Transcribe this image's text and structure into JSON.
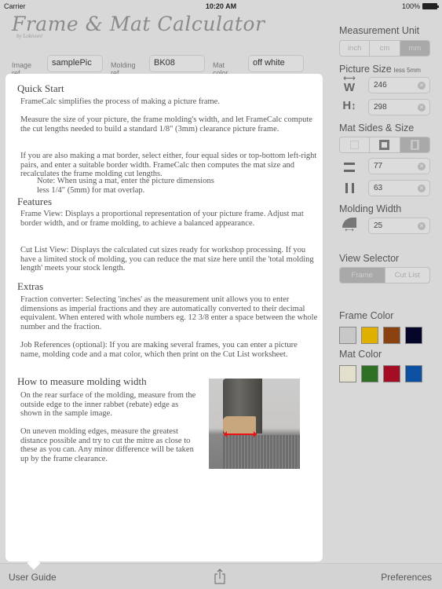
{
  "status_bar": {
    "carrier": "Carrier",
    "time": "10:20 AM",
    "battery": "100%"
  },
  "header": {
    "title": "Frame & Mat Calculator",
    "byline": "by Lokivoré",
    "image_ref_label": "Image ref.",
    "image_ref_value": "samplePic",
    "molding_ref_label": "Molding ref.",
    "molding_ref_value": "BK08",
    "mat_color_label": "Mat color",
    "mat_color_value": "off white"
  },
  "guide": {
    "sections": [
      {
        "heading": "Quick Start",
        "paragraphs": [
          "FrameCalc simplifies the process of making a picture frame.",
          "Measure the size of your picture, the frame molding's width, and let FrameCalc compute the cut lengths needed to build a standard 1/8\" (3mm) clearance picture frame.",
          "If you are also making a mat border, select either, four equal sides or top-bottom left-right pairs, and enter a suitable border width. FrameCalc then computes the mat size and recalculates the frame molding cut lengths.",
          "Note: When using a mat, enter the picture dimensions less 1/4\" (5mm) for mat overlap."
        ]
      },
      {
        "heading": "Features",
        "paragraphs": [
          "Frame View: Displays a proportional representation of your picture frame. Adjust mat border width, and or frame molding, to achieve a balanced appearance.",
          "Cut List View: Displays the calculated cut sizes ready for workshop processing. If you have a limited stock of molding, you can reduce the mat size here until the 'total molding length' meets your stock length."
        ]
      },
      {
        "heading": "Extras",
        "paragraphs": [
          "Fraction converter: Selecting 'inches' as the measurement unit allows you to enter dimensions as imperial fractions and they are automatically converted to their decimal equivalent. When entered with whole numbers eg. 12  3/8 enter a space between the whole number and the fraction.",
          "Job References (optional): If you are making several frames, you can enter a picture name, molding code and a mat color, which then print on the Cut List worksheet."
        ]
      },
      {
        "heading": "How to measure molding width",
        "paragraphs": [
          "On the rear surface of the molding, measure from the outside edge to the inner rabbet (rebate) edge as shown in the sample image.",
          "On uneven molding edges, measure the greatest distance possible and try to cut the mitre as close to these as you can. Any minor difference will be taken up by the frame clearance."
        ]
      }
    ],
    "image_alt": "molding-measurement-sample"
  },
  "panel": {
    "measurement_unit": {
      "label": "Measurement Unit",
      "options": [
        "inch",
        "cm",
        "mm"
      ],
      "selected": "mm"
    },
    "picture_size": {
      "label": "Picture Size",
      "note": "less 5mm",
      "width": "246",
      "height": "298",
      "w_letter": "W",
      "h_letter": "H"
    },
    "mat_sides": {
      "label": "Mat Sides & Size",
      "options": [
        "none",
        "four-equal",
        "pairs"
      ],
      "selected": "pairs",
      "top_bottom": "77",
      "left_right": "63"
    },
    "molding_width": {
      "label": "Molding Width",
      "value": "25"
    },
    "view_selector": {
      "label": "View Selector",
      "options": [
        "Frame",
        "Cut List"
      ],
      "selected": "Frame"
    },
    "frame_color": {
      "label": "Frame Color",
      "swatches": [
        "#c8c8c8",
        "#e0b000",
        "#8a4310",
        "#06062a"
      ]
    },
    "mat_color": {
      "label": "Mat Color",
      "swatches": [
        "#e2e0cc",
        "#2f7024",
        "#a50d24",
        "#0d50a2"
      ]
    }
  },
  "tabbar": {
    "left": "User Guide",
    "right": "Preferences"
  }
}
